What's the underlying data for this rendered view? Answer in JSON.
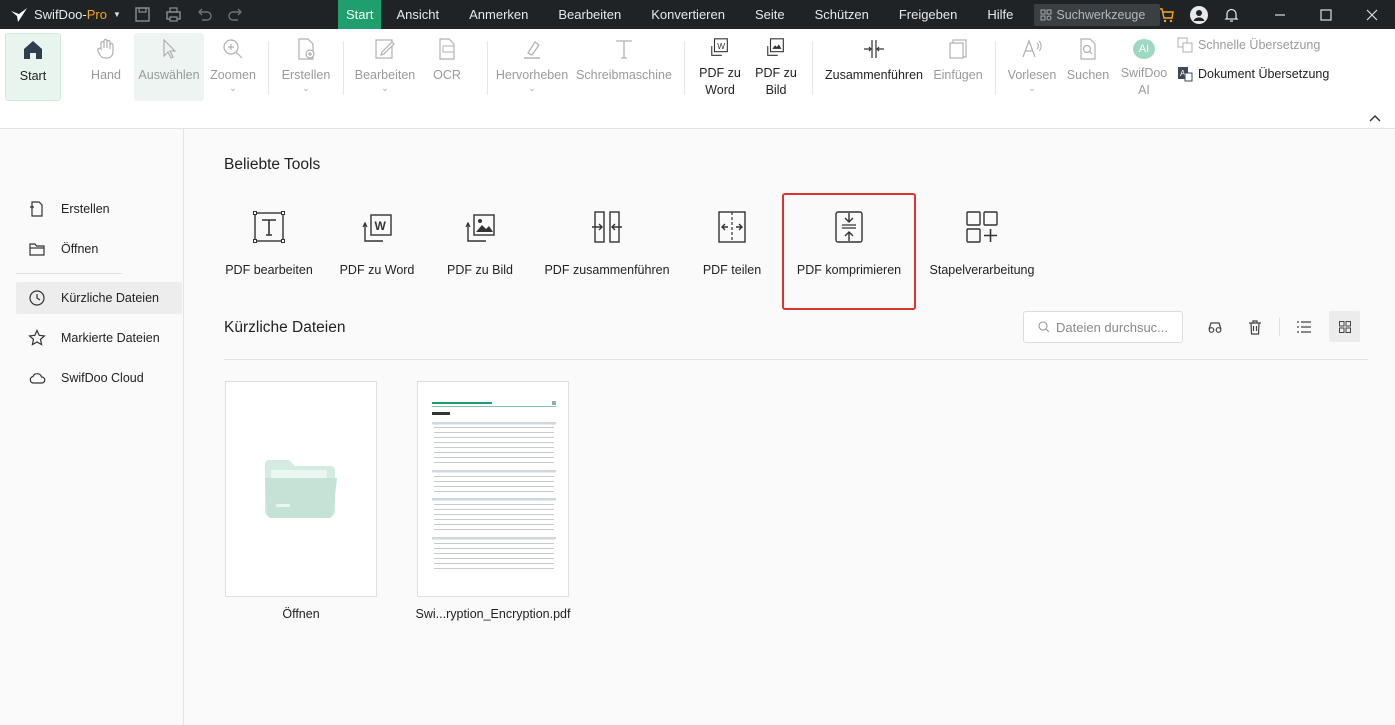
{
  "app": {
    "name": "SwifDoo-",
    "name_suffix": "Pro"
  },
  "menu": [
    "Start",
    "Ansicht",
    "Anmerken",
    "Bearbeiten",
    "Konvertieren",
    "Seite",
    "Schützen",
    "Freigeben",
    "Hilfe"
  ],
  "menu_active": "Start",
  "search_tools": {
    "placeholder": "Suchwerkzeuge"
  },
  "ribbon": {
    "start": "Start",
    "hand": "Hand",
    "select": "Auswählen",
    "zoom": "Zoomen",
    "create": "Erstellen",
    "edit": "Bearbeiten",
    "ocr": "OCR",
    "highlight": "Hervorheben",
    "typewriter": "Schreibmaschine",
    "pdf_to_word_1": "PDF zu",
    "pdf_to_word_2": "Word",
    "pdf_to_image_1": "PDF zu",
    "pdf_to_image_2": "Bild",
    "merge": "Zusammenführen",
    "insert": "Einfügen",
    "read": "Vorlesen",
    "search": "Suchen",
    "ai_1": "SwifDoo",
    "ai_2": "AI",
    "ai_badge": "AI",
    "quick_translate": "Schnelle Übersetzung",
    "doc_translate": "Dokument Übersetzung"
  },
  "sidebar": {
    "items": [
      {
        "label": "Erstellen",
        "icon": "create-icon"
      },
      {
        "label": "Öffnen",
        "icon": "folder-icon"
      },
      {
        "label": "Kürzliche Dateien",
        "icon": "clock-icon"
      },
      {
        "label": "Markierte Dateien",
        "icon": "star-icon"
      },
      {
        "label": "SwifDoo Cloud",
        "icon": "cloud-icon"
      }
    ],
    "active": "Kürzliche Dateien"
  },
  "popular_tools": {
    "title": "Beliebte Tools",
    "items": [
      "PDF bearbeiten",
      "PDF zu Word",
      "PDF zu Bild",
      "PDF zusammenführen",
      "PDF teilen",
      "PDF komprimieren",
      "Stapelverarbeitung"
    ],
    "highlighted": "PDF komprimieren"
  },
  "recent": {
    "title": "Kürzliche Dateien",
    "search_placeholder": "Dateien durchsuc...",
    "files": [
      {
        "label": "Öffnen"
      },
      {
        "label": "Swi...ryption_Encryption.pdf"
      }
    ]
  },
  "colors": {
    "accent": "#1e9f6d",
    "titlebar": "#1f2326",
    "highlight_border": "#e03131",
    "folder": "#c4e3d6"
  }
}
